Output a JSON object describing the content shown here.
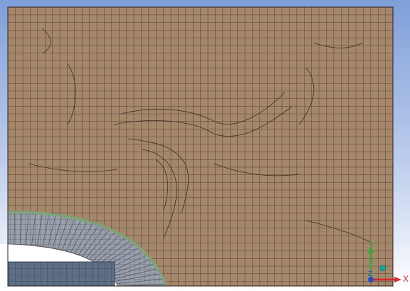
{
  "viewport": {
    "background_top": "#7f9fd9",
    "background_bottom": "#ffffff"
  },
  "mesh": {
    "block_fill": "#a5876c",
    "block_grid_color": "#3d2e22",
    "hole_region_fill": "#99a0ab",
    "hole_grid_color": "#4a5260",
    "inflation_edge_color": "#7fa27a",
    "insert_fill": "#5d6f84"
  },
  "triad": {
    "x_axis_color": "#d8262c",
    "y_axis_color": "#33a83a",
    "z_axis_color": "#2a49c6",
    "iso_ball_color": "#16a6a0",
    "x_label": "X",
    "y_label": "Y",
    "z_label": "Z"
  }
}
